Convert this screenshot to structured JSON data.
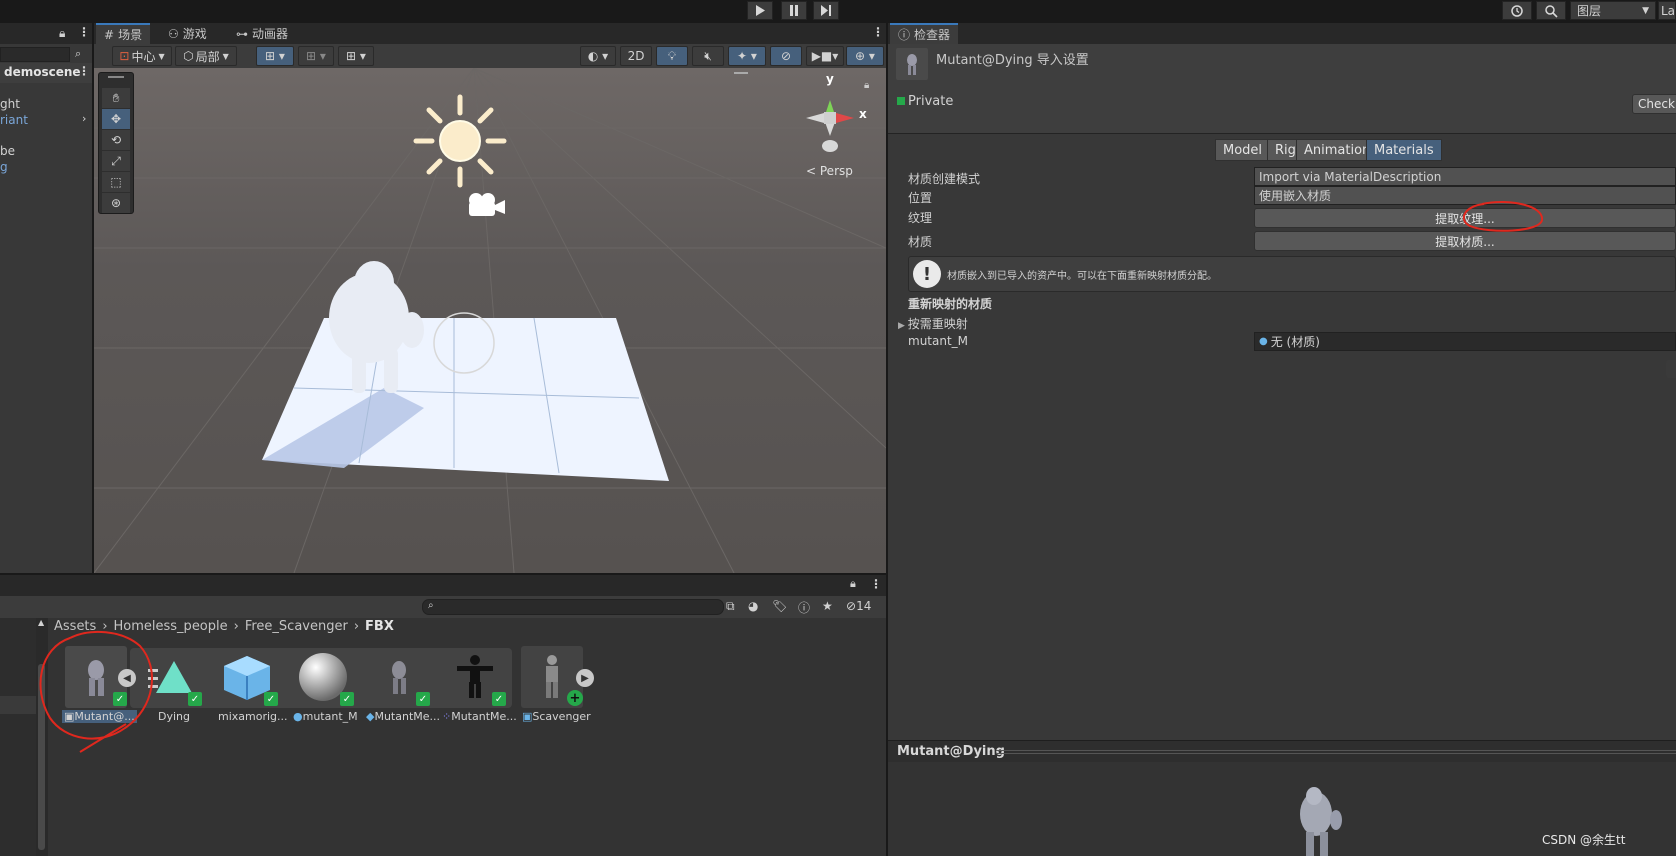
{
  "toolbar": {
    "layers_label": "图层",
    "layout_label": "La"
  },
  "scene_tabs": [
    "场景",
    "游戏",
    "动画器"
  ],
  "scene_toolbar": {
    "pivot": "中心",
    "space": "局部",
    "mode_2d": "2D"
  },
  "hierarchy": {
    "scene_name": "demoscene",
    "items": [
      "ght",
      "riant",
      "be",
      "g"
    ]
  },
  "gizmo": {
    "y": "y",
    "x": "x",
    "persp": "Persp"
  },
  "inspector": {
    "tab": "检查器",
    "title": "Mutant@Dying 导入设置",
    "private_label": "Private",
    "check_button": "Check",
    "tabs": [
      "Model",
      "Rig",
      "Animation",
      "Materials"
    ],
    "active_tab": "Materials",
    "rows": {
      "creation_mode_label": "材质创建模式",
      "creation_mode_value": "Import via MaterialDescription",
      "location_label": "位置",
      "location_value": "使用嵌入材质",
      "textures_label": "纹理",
      "extract_textures": "提取纹理...",
      "materials_label": "材质",
      "extract_materials": "提取材质..."
    },
    "info_text": "材质嵌入到已导入的资产中。可以在下面重新映射材质分配。",
    "remap_header": "重新映射的材质",
    "remap_on_demand": "按需重映射",
    "remap_item_label": "mutant_M",
    "remap_item_value": "无 (材质)",
    "preview_title": "Mutant@Dying"
  },
  "project": {
    "breadcrumb": [
      "Assets",
      "Homeless_people",
      "Free_Scavenger",
      "FBX"
    ],
    "hidden_count": "14",
    "assets": [
      "Mutant@...",
      "Dying",
      "mixamorig...",
      "mutant_M",
      "MutantMe...",
      "MutantMe...",
      "Scavenger"
    ]
  },
  "watermark": "CSDN @余生tt",
  "colors": {
    "accent": "#46607c",
    "annotation": "#e0281e",
    "check": "#25a84a"
  }
}
